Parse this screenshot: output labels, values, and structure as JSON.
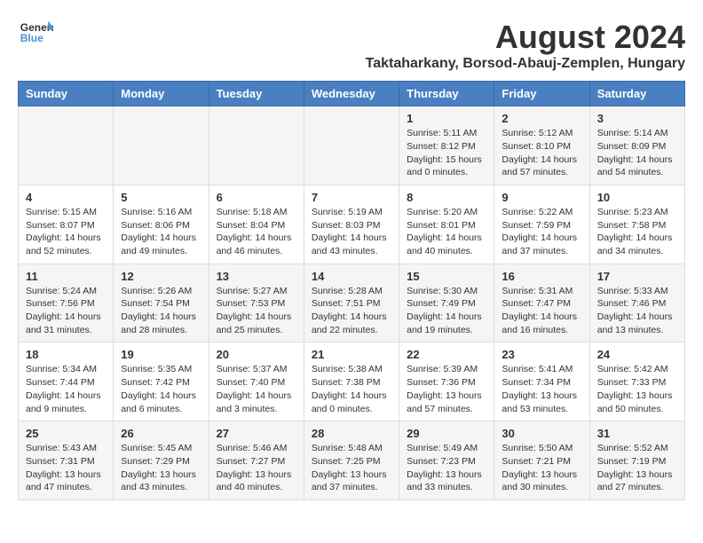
{
  "header": {
    "logo_general": "General",
    "logo_blue": "Blue",
    "month_title": "August 2024",
    "location": "Taktaharkany, Borsod-Abauj-Zemplen, Hungary"
  },
  "weekdays": [
    "Sunday",
    "Monday",
    "Tuesday",
    "Wednesday",
    "Thursday",
    "Friday",
    "Saturday"
  ],
  "weeks": [
    [
      {
        "day": "",
        "info": ""
      },
      {
        "day": "",
        "info": ""
      },
      {
        "day": "",
        "info": ""
      },
      {
        "day": "",
        "info": ""
      },
      {
        "day": "1",
        "info": "Sunrise: 5:11 AM\nSunset: 8:12 PM\nDaylight: 15 hours\nand 0 minutes."
      },
      {
        "day": "2",
        "info": "Sunrise: 5:12 AM\nSunset: 8:10 PM\nDaylight: 14 hours\nand 57 minutes."
      },
      {
        "day": "3",
        "info": "Sunrise: 5:14 AM\nSunset: 8:09 PM\nDaylight: 14 hours\nand 54 minutes."
      }
    ],
    [
      {
        "day": "4",
        "info": "Sunrise: 5:15 AM\nSunset: 8:07 PM\nDaylight: 14 hours\nand 52 minutes."
      },
      {
        "day": "5",
        "info": "Sunrise: 5:16 AM\nSunset: 8:06 PM\nDaylight: 14 hours\nand 49 minutes."
      },
      {
        "day": "6",
        "info": "Sunrise: 5:18 AM\nSunset: 8:04 PM\nDaylight: 14 hours\nand 46 minutes."
      },
      {
        "day": "7",
        "info": "Sunrise: 5:19 AM\nSunset: 8:03 PM\nDaylight: 14 hours\nand 43 minutes."
      },
      {
        "day": "8",
        "info": "Sunrise: 5:20 AM\nSunset: 8:01 PM\nDaylight: 14 hours\nand 40 minutes."
      },
      {
        "day": "9",
        "info": "Sunrise: 5:22 AM\nSunset: 7:59 PM\nDaylight: 14 hours\nand 37 minutes."
      },
      {
        "day": "10",
        "info": "Sunrise: 5:23 AM\nSunset: 7:58 PM\nDaylight: 14 hours\nand 34 minutes."
      }
    ],
    [
      {
        "day": "11",
        "info": "Sunrise: 5:24 AM\nSunset: 7:56 PM\nDaylight: 14 hours\nand 31 minutes."
      },
      {
        "day": "12",
        "info": "Sunrise: 5:26 AM\nSunset: 7:54 PM\nDaylight: 14 hours\nand 28 minutes."
      },
      {
        "day": "13",
        "info": "Sunrise: 5:27 AM\nSunset: 7:53 PM\nDaylight: 14 hours\nand 25 minutes."
      },
      {
        "day": "14",
        "info": "Sunrise: 5:28 AM\nSunset: 7:51 PM\nDaylight: 14 hours\nand 22 minutes."
      },
      {
        "day": "15",
        "info": "Sunrise: 5:30 AM\nSunset: 7:49 PM\nDaylight: 14 hours\nand 19 minutes."
      },
      {
        "day": "16",
        "info": "Sunrise: 5:31 AM\nSunset: 7:47 PM\nDaylight: 14 hours\nand 16 minutes."
      },
      {
        "day": "17",
        "info": "Sunrise: 5:33 AM\nSunset: 7:46 PM\nDaylight: 14 hours\nand 13 minutes."
      }
    ],
    [
      {
        "day": "18",
        "info": "Sunrise: 5:34 AM\nSunset: 7:44 PM\nDaylight: 14 hours\nand 9 minutes."
      },
      {
        "day": "19",
        "info": "Sunrise: 5:35 AM\nSunset: 7:42 PM\nDaylight: 14 hours\nand 6 minutes."
      },
      {
        "day": "20",
        "info": "Sunrise: 5:37 AM\nSunset: 7:40 PM\nDaylight: 14 hours\nand 3 minutes."
      },
      {
        "day": "21",
        "info": "Sunrise: 5:38 AM\nSunset: 7:38 PM\nDaylight: 14 hours\nand 0 minutes."
      },
      {
        "day": "22",
        "info": "Sunrise: 5:39 AM\nSunset: 7:36 PM\nDaylight: 13 hours\nand 57 minutes."
      },
      {
        "day": "23",
        "info": "Sunrise: 5:41 AM\nSunset: 7:34 PM\nDaylight: 13 hours\nand 53 minutes."
      },
      {
        "day": "24",
        "info": "Sunrise: 5:42 AM\nSunset: 7:33 PM\nDaylight: 13 hours\nand 50 minutes."
      }
    ],
    [
      {
        "day": "25",
        "info": "Sunrise: 5:43 AM\nSunset: 7:31 PM\nDaylight: 13 hours\nand 47 minutes."
      },
      {
        "day": "26",
        "info": "Sunrise: 5:45 AM\nSunset: 7:29 PM\nDaylight: 13 hours\nand 43 minutes."
      },
      {
        "day": "27",
        "info": "Sunrise: 5:46 AM\nSunset: 7:27 PM\nDaylight: 13 hours\nand 40 minutes."
      },
      {
        "day": "28",
        "info": "Sunrise: 5:48 AM\nSunset: 7:25 PM\nDaylight: 13 hours\nand 37 minutes."
      },
      {
        "day": "29",
        "info": "Sunrise: 5:49 AM\nSunset: 7:23 PM\nDaylight: 13 hours\nand 33 minutes."
      },
      {
        "day": "30",
        "info": "Sunrise: 5:50 AM\nSunset: 7:21 PM\nDaylight: 13 hours\nand 30 minutes."
      },
      {
        "day": "31",
        "info": "Sunrise: 5:52 AM\nSunset: 7:19 PM\nDaylight: 13 hours\nand 27 minutes."
      }
    ]
  ]
}
